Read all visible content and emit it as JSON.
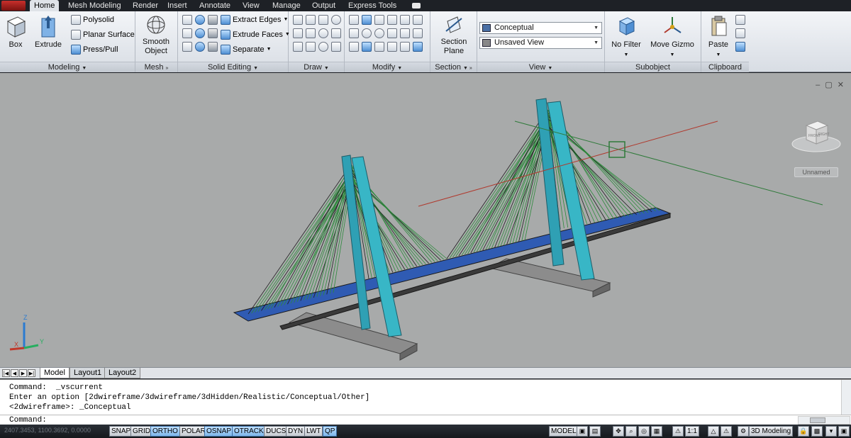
{
  "tabs": [
    "Home",
    "Mesh Modeling",
    "Render",
    "Insert",
    "Annotate",
    "View",
    "Manage",
    "Output",
    "Express Tools"
  ],
  "active_tab": "Home",
  "panels": {
    "modeling": {
      "title": "Modeling",
      "box_label": "Box",
      "extrude_label": "Extrude",
      "polysolid_label": "Polysolid",
      "planar_surface_label": "Planar Surface",
      "presspull_label": "Press/Pull"
    },
    "mesh": {
      "title": "Mesh",
      "smooth_object_label": "Smooth Object"
    },
    "solid_editing": {
      "title": "Solid Editing",
      "extract_edges_label": "Extract Edges",
      "extrude_faces_label": "Extrude Faces",
      "separate_label": "Separate"
    },
    "draw": {
      "title": "Draw"
    },
    "modify": {
      "title": "Modify"
    },
    "section": {
      "title": "Section",
      "section_plane_label": "Section Plane"
    },
    "view": {
      "title": "View",
      "visual_style": "Conceptual",
      "named_view": "Unsaved View"
    },
    "subobject": {
      "title": "Subobject",
      "no_filter_label": "No Filter",
      "move_gizmo_label": "Move Gizmo"
    },
    "clipboard": {
      "title": "Clipboard",
      "paste_label": "Paste"
    }
  },
  "viewport": {
    "viewcube_faces": [
      "TOP",
      "FRONT",
      "RIGHT"
    ],
    "named_view": "Unnamed",
    "ucs_axes": [
      "X",
      "Y",
      "Z"
    ]
  },
  "layout_tabs": [
    "Model",
    "Layout1",
    "Layout2"
  ],
  "active_layout": "Model",
  "command_history": [
    "Command:  _vscurrent",
    "Enter an option [2dwireframe/3dwireframe/3dHidden/Realistic/Conceptual/Other]",
    "<2dwireframe>: _Conceptual"
  ],
  "command_prompt": "Command:",
  "status": {
    "coordinates": "2407.3453, 1100.3692, 0.0000",
    "toggles": [
      {
        "label": "SNAP",
        "on": false
      },
      {
        "label": "GRID",
        "on": false
      },
      {
        "label": "ORTHO",
        "on": true
      },
      {
        "label": "POLAR",
        "on": false
      },
      {
        "label": "OSNAP",
        "on": true
      },
      {
        "label": "OTRACK",
        "on": true
      },
      {
        "label": "DUCS",
        "on": false
      },
      {
        "label": "DYN",
        "on": false
      },
      {
        "label": "LWT",
        "on": false
      },
      {
        "label": "QP",
        "on": true
      }
    ],
    "model_label": "MODEL",
    "scale_label": "1:1",
    "workspace_label": "3D Modeling"
  },
  "colors": {
    "deck": "#2f5bb3",
    "pylon": "#38b6c6",
    "cables": "#2d8a3c",
    "ground": "#8c8c8c",
    "x_axis_line": "#b03a2e",
    "y_axis_line": "#2f7a3a"
  }
}
